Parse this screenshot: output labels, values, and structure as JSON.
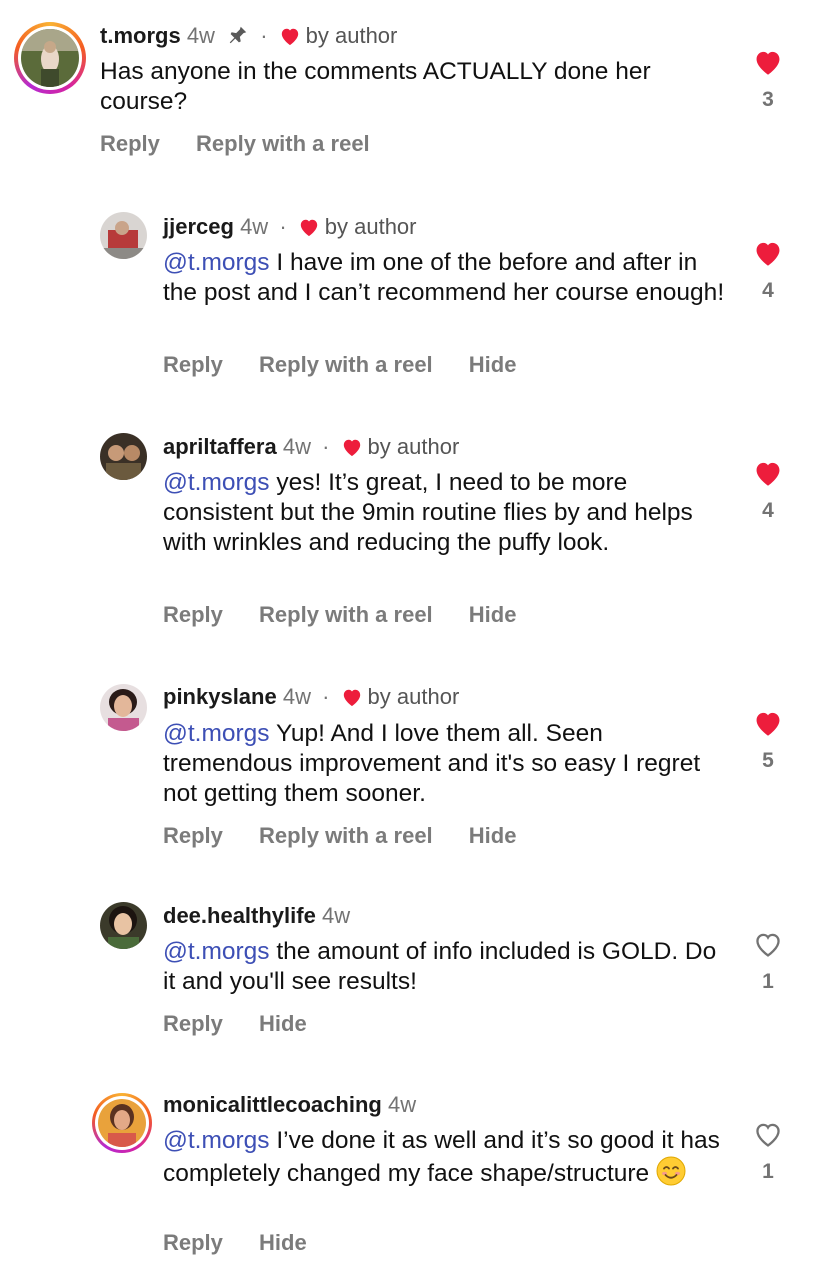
{
  "comments": [
    {
      "username": "t.morgs",
      "age": "4w",
      "liked_by_author": "by author",
      "pinned": true,
      "mention": "",
      "text": "Has anyone in the comments ACTUALLY done her course?",
      "actions": [
        "Reply",
        "Reply with a reel"
      ],
      "like_count": "3",
      "liked": true,
      "avatar_icon": "user-photo"
    },
    {
      "username": "jjerceg",
      "age": "4w",
      "liked_by_author": "by author",
      "mention": "@t.morgs",
      "text": "I have im one of the before and after in the post and I can’t recommend her course enough!",
      "actions": [
        "Reply",
        "Reply with a reel",
        "Hide"
      ],
      "like_count": "4",
      "liked": true,
      "avatar_icon": "user-photo"
    },
    {
      "username": "apriltaffera",
      "age": "4w",
      "liked_by_author": "by author",
      "mention": "@t.morgs",
      "text": "yes! It’s great, I need to be more consistent but the 9min routine flies by and helps with wrinkles and reducing the puffy look.",
      "actions": [
        "Reply",
        "Reply with a reel",
        "Hide"
      ],
      "like_count": "4",
      "liked": true,
      "avatar_icon": "user-photo"
    },
    {
      "username": "pinkyslane",
      "age": "4w",
      "liked_by_author": "by author",
      "mention": "@t.morgs",
      "text": "Yup! And I love them all. Seen tremendous improvement and it's so easy I regret not getting them sooner.",
      "actions": [
        "Reply",
        "Reply with a reel",
        "Hide"
      ],
      "like_count": "5",
      "liked": true,
      "avatar_icon": "user-photo"
    },
    {
      "username": "dee.healthylife",
      "age": "4w",
      "liked_by_author": "",
      "mention": "@t.morgs",
      "text": "the amount of info included is GOLD. Do it and you'll see results!",
      "actions": [
        "Reply",
        "Hide"
      ],
      "like_count": "1",
      "liked": false,
      "avatar_icon": "user-photo"
    },
    {
      "username": "monicalittlecoaching",
      "age": "4w",
      "liked_by_author": "",
      "mention": "@t.morgs",
      "text": "I’ve done it as well and it’s so good it has completely changed my face shape/structure",
      "emoji": "smiling-face-icon",
      "actions": [
        "Reply",
        "Hide"
      ],
      "like_count": "1",
      "liked": false,
      "avatar_icon": "user-photo"
    }
  ],
  "colors": {
    "heart_red": "#ed1d3c",
    "mention_blue": "#3d4fb5",
    "muted_gray": "#737373"
  }
}
